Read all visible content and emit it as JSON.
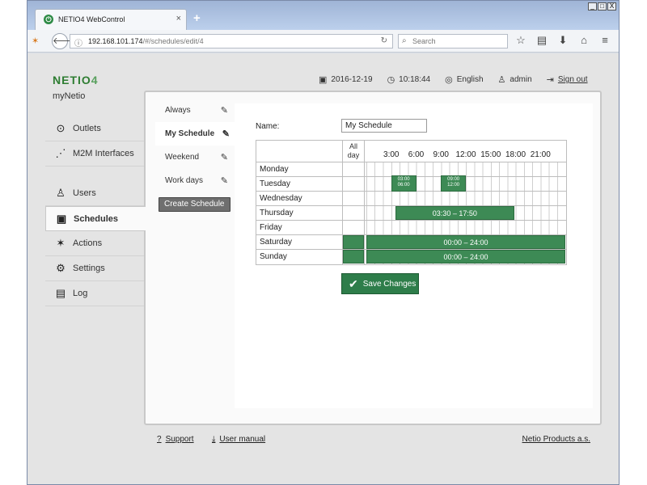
{
  "browser": {
    "tab_title": "NETIO4 WebControl",
    "tab_close": "×",
    "new_tab": "+",
    "url_host": "192.168.101.174",
    "url_path": "/#/schedules/edit/4",
    "search_placeholder": "Search",
    "win_minimize": "_",
    "win_restore": "□",
    "win_close": "X"
  },
  "header": {
    "logo_text": "NETIO",
    "logo_number": "4",
    "subtitle": "myNetio",
    "date": "2016-12-19",
    "time": "10:18:44",
    "language": "English",
    "user": "admin",
    "sign_out": "Sign out"
  },
  "sidebar": {
    "items": [
      {
        "label": "Outlets",
        "icon": "outlet-icon"
      },
      {
        "label": "M2M Interfaces",
        "icon": "m2m-icon"
      },
      {
        "label": "Users",
        "icon": "user-icon"
      },
      {
        "label": "Schedules",
        "icon": "calendar-icon",
        "active": true
      },
      {
        "label": "Actions",
        "icon": "wand-icon"
      },
      {
        "label": "Settings",
        "icon": "gear-icon"
      },
      {
        "label": "Log",
        "icon": "document-icon"
      }
    ]
  },
  "schedules": {
    "items": [
      {
        "label": "Always"
      },
      {
        "label": "My Schedule",
        "active": true
      },
      {
        "label": "Weekend"
      },
      {
        "label": "Work days"
      }
    ],
    "create_label": "Create Schedule"
  },
  "editor": {
    "name_label": "Name:",
    "name_value": "My Schedule",
    "allday_header": "All day",
    "hours": [
      "3:00",
      "6:00",
      "9:00",
      "12:00",
      "15:00",
      "18:00",
      "21:00"
    ],
    "days": [
      "Monday",
      "Tuesday",
      "Wednesday",
      "Thursday",
      "Friday",
      "Saturday",
      "Sunday"
    ],
    "intervals": [
      {
        "day": 1,
        "start": 3,
        "end": 6,
        "start_label": "03:00",
        "end_label": "06:00"
      },
      {
        "day": 1,
        "start": 9,
        "end": 12,
        "start_label": "09:00",
        "end_label": "12:00"
      },
      {
        "day": 3,
        "start": 3.5,
        "end": 17.833,
        "label": "03:30 – 17:50"
      },
      {
        "day": 5,
        "start": 0,
        "end": 24,
        "label": "00:00 – 24:00"
      },
      {
        "day": 6,
        "start": 0,
        "end": 24,
        "label": "00:00 – 24:00"
      }
    ],
    "allday_days": [
      5,
      6
    ],
    "save_label": "Save Changes"
  },
  "footer": {
    "support": "Support",
    "manual": "User manual",
    "company": "Netio Products a.s."
  },
  "colors": {
    "accent": "#2e7d4a",
    "bar": "#3d8a55",
    "logo": "#2e7d32"
  }
}
